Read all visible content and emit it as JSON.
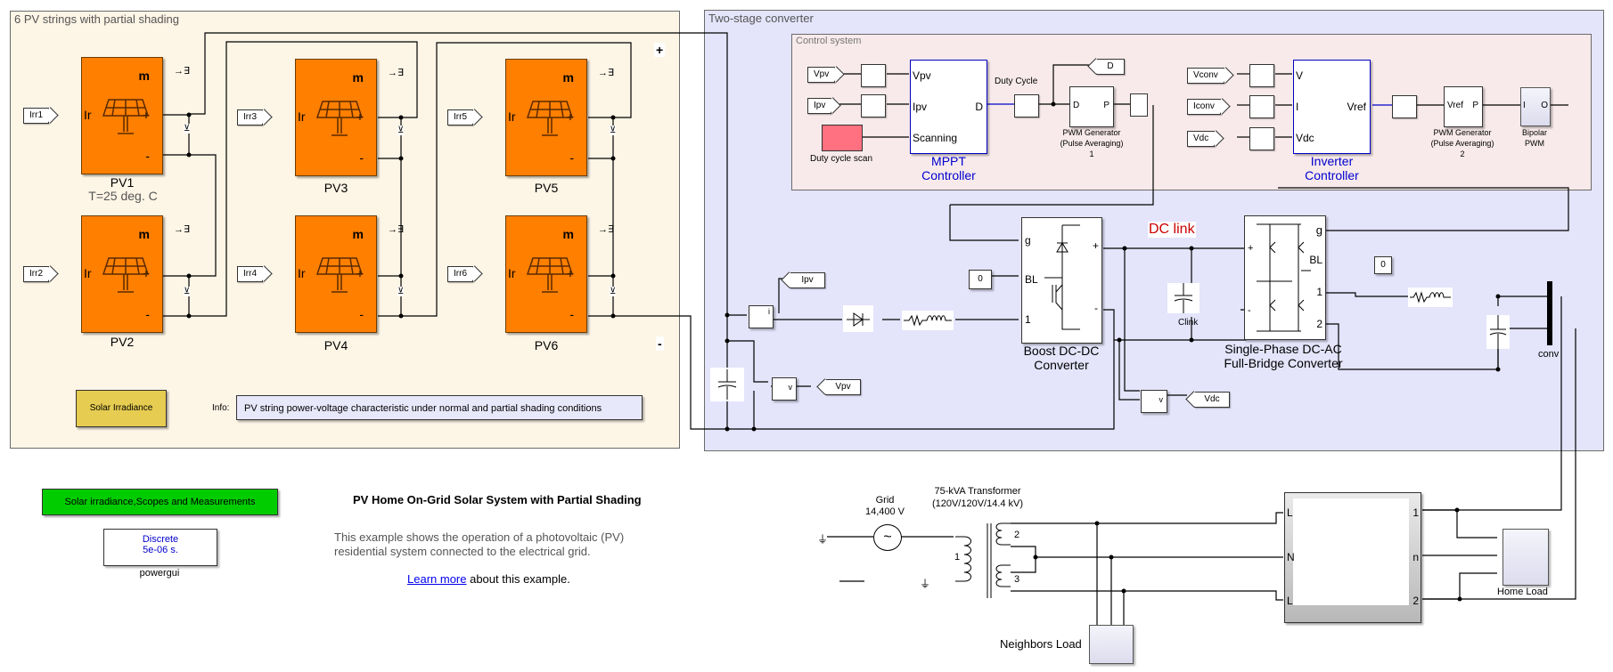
{
  "model_title": "PV Home On-Grid Solar System with Partial Shading",
  "description_line1": "This example shows the operation of a photovoltaic (PV)",
  "description_line2": "residential system connected to the electrical grid.",
  "learn_more_link": "Learn more",
  "learn_more_suffix": " about this example.",
  "pv_area": {
    "title": "6 PV strings with partial shading",
    "plus_terminal": "+",
    "minus_terminal": "-",
    "temperature_note": "T=25 deg. C",
    "arrays": [
      {
        "name": "PV1",
        "input": "Irr1",
        "port_ir": "Ir",
        "port_m": "m",
        "port_plus": "+",
        "port_minus": "-"
      },
      {
        "name": "PV2",
        "input": "Irr2",
        "port_ir": "Ir",
        "port_m": "m",
        "port_plus": "+",
        "port_minus": "-"
      },
      {
        "name": "PV3",
        "input": "Irr3",
        "port_ir": "Ir",
        "port_m": "m",
        "port_plus": "+",
        "port_minus": "-"
      },
      {
        "name": "PV4",
        "input": "Irr4",
        "port_ir": "Ir",
        "port_m": "m",
        "port_plus": "+",
        "port_minus": "-"
      },
      {
        "name": "PV5",
        "input": "Irr5",
        "port_ir": "Ir",
        "port_m": "m",
        "port_plus": "+",
        "port_minus": "-"
      },
      {
        "name": "PV6",
        "input": "Irr6",
        "port_ir": "Ir",
        "port_m": "m",
        "port_plus": "+",
        "port_minus": "-"
      }
    ],
    "solar_irradiance_block": "Solar Irradiance",
    "info_label": "Info:",
    "info_text": "PV string power-voltage characteristic under normal and partial shading conditions"
  },
  "converter_area": {
    "title": "Two-stage converter",
    "control_system": {
      "title": "Control system",
      "mppt_inputs": [
        "Vpv",
        "Ipv"
      ],
      "duty_cycle_scan": "Duty cycle scan",
      "mppt_ports": {
        "in1": "Vpv",
        "in2": "Ipv",
        "in3": "Scanning",
        "out": "D"
      },
      "mppt_name_line1": "MPPT",
      "mppt_name_line2": "Controller",
      "duty_cycle_label": "Duty Cycle",
      "duty_goto": "D",
      "pwm1_ports": {
        "in": "D",
        "out": "P"
      },
      "pwm1_label_line1": "PWM Generator",
      "pwm1_label_line2": "(Pulse Averaging)",
      "pwm1_label_line3": "1",
      "inverter_inputs": [
        "Vconv",
        "Iconv",
        "Vdc"
      ],
      "inverter_ports": {
        "in1": "V",
        "in2": "I",
        "in3": "Vdc",
        "out": "Vref"
      },
      "inverter_name_line1": "Inverter",
      "inverter_name_line2": "Controller",
      "pwm2_ports": {
        "in": "Vref",
        "out": "P"
      },
      "pwm2_label_line1": "PWM Generator",
      "pwm2_label_line2": "(Pulse Averaging)",
      "pwm2_label_line3": "2",
      "bipolar_ports": {
        "in": "I",
        "out": "O"
      },
      "bipolar_label_line1": "Bipolar",
      "bipolar_label_line2": "PWM"
    },
    "ipv_goto": "Ipv",
    "vpv_goto": "Vpv",
    "vdc_goto": "Vdc",
    "boost_ports": {
      "g": "g",
      "bl": "BL",
      "in1": "1",
      "plus": "+",
      "minus": "-"
    },
    "boost_label_line1": "Boost DC-DC",
    "boost_label_line2": "Converter",
    "boost_const": "0",
    "dc_link_label": "DC link",
    "clink_label": "Clink",
    "inverter_bridge_ports": {
      "g": "g",
      "bl": "BL",
      "out1": "1",
      "out2": "2",
      "plus": "+",
      "minus": "-"
    },
    "inverter_bridge_const": "0",
    "inverter_bridge_label_line1": "Single-Phase DC-AC",
    "inverter_bridge_label_line2": "Full-Bridge Converter",
    "conv_label": "conv",
    "current_meas_port": "i",
    "voltage_meas_port": "v"
  },
  "grid_section": {
    "grid_label_line1": "Grid",
    "grid_label_line2": "14,400 V",
    "transformer_label_line1": "75-kVA Transformer",
    "transformer_label_line2": "(120V/120V/14.4 kV)",
    "winding_1": "1",
    "winding_2": "2",
    "winding_3": "3",
    "neighbors_load": "Neighbors Load",
    "meter_ports_left": [
      "L",
      "N",
      "L"
    ],
    "meter_ports_right": [
      "1",
      "n",
      "2"
    ],
    "home_load": "Home Load"
  },
  "subsystem_green": "Solar irradiance,Scopes and Measurements",
  "powergui": {
    "line1": "Discrete",
    "line2": "5e-06 s.",
    "label": "powergui"
  },
  "colors": {
    "pv_area_bg": "#fdf5e6",
    "converter_area_bg": "#e4e4fb",
    "control_area_bg": "#f8eaea",
    "pv_block": "#ff7f00",
    "irradiance_block": "#e6cc50",
    "green_block": "#00cc00",
    "scan_block": "#ff7080",
    "link_blue": "#0000ee",
    "dc_link_red": "#cc0000"
  }
}
